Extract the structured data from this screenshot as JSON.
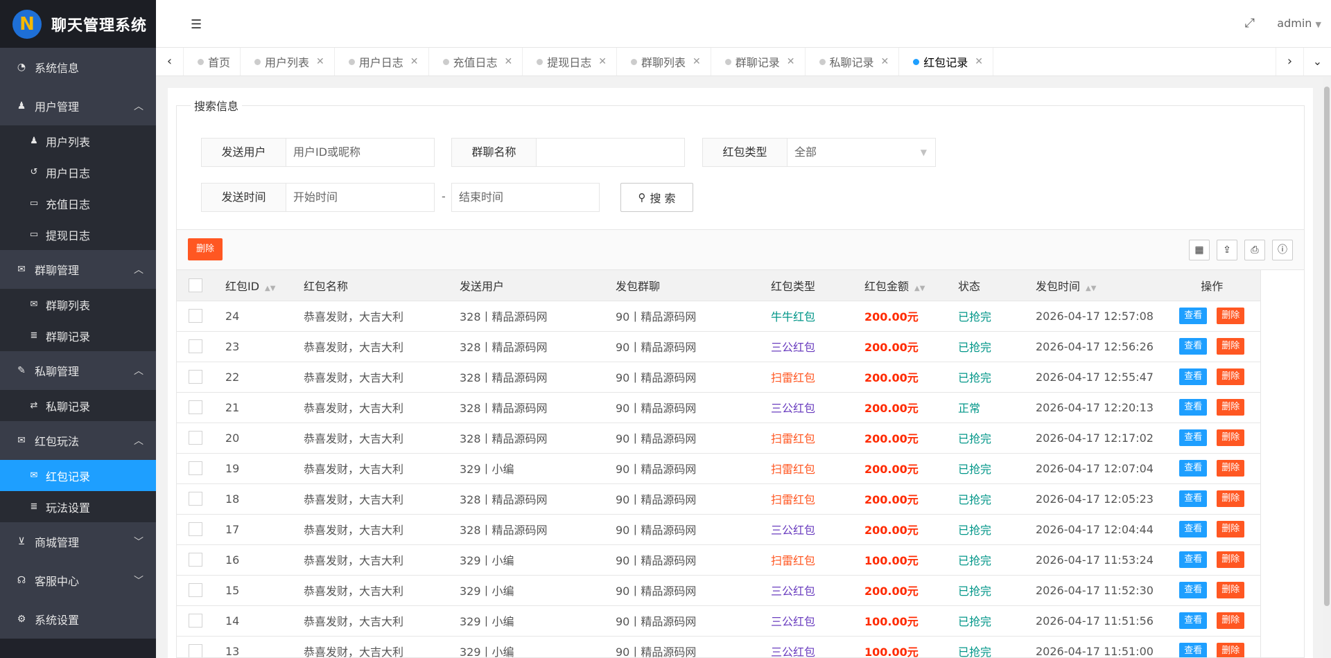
{
  "app": {
    "title": "聊天管理系统"
  },
  "sidebar": {
    "groups": [
      {
        "label": "系统信息",
        "icon": "dashboard-icon",
        "children": []
      },
      {
        "label": "用户管理",
        "icon": "user-icon",
        "expanded": true,
        "children": [
          {
            "label": "用户列表",
            "icon": "users-icon"
          },
          {
            "label": "用户日志",
            "icon": "history-icon"
          },
          {
            "label": "充值日志",
            "icon": "card-icon"
          },
          {
            "label": "提现日志",
            "icon": "card-icon"
          }
        ]
      },
      {
        "label": "群聊管理",
        "icon": "chat-icon",
        "expanded": true,
        "children": [
          {
            "label": "群聊列表",
            "icon": "chat-icon"
          },
          {
            "label": "群聊记录",
            "icon": "list-icon"
          }
        ]
      },
      {
        "label": "私聊管理",
        "icon": "comment-icon",
        "expanded": true,
        "children": [
          {
            "label": "私聊记录",
            "icon": "exchange-icon"
          }
        ]
      },
      {
        "label": "红包玩法",
        "icon": "chat-icon",
        "expanded": true,
        "children": [
          {
            "label": "红包记录",
            "icon": "chat-icon",
            "active": true
          },
          {
            "label": "玩法设置",
            "icon": "list-icon"
          }
        ]
      },
      {
        "label": "商城管理",
        "icon": "cart-icon",
        "expanded": false,
        "children": []
      },
      {
        "label": "客服中心",
        "icon": "headset-icon",
        "expanded": false,
        "children": []
      },
      {
        "label": "系统设置",
        "icon": "gears-icon",
        "children": []
      }
    ]
  },
  "header": {
    "user": "admin"
  },
  "tabs": [
    {
      "label": "首页",
      "closable": false
    },
    {
      "label": "用户列表",
      "closable": true
    },
    {
      "label": "用户日志",
      "closable": true
    },
    {
      "label": "充值日志",
      "closable": true
    },
    {
      "label": "提现日志",
      "closable": true
    },
    {
      "label": "群聊列表",
      "closable": true
    },
    {
      "label": "群聊记录",
      "closable": true
    },
    {
      "label": "私聊记录",
      "closable": true
    },
    {
      "label": "红包记录",
      "closable": true,
      "active": true
    }
  ],
  "search": {
    "legend": "搜索信息",
    "sender_label": "发送用户",
    "sender_placeholder": "用户ID或昵称",
    "group_label": "群聊名称",
    "group_value": "",
    "type_label": "红包类型",
    "type_value": "全部",
    "time_label": "发送时间",
    "start_placeholder": "开始时间",
    "dash": "-",
    "end_placeholder": "结束时间",
    "button": "搜 索"
  },
  "toolbar": {
    "delete_label": "删除"
  },
  "table": {
    "headers": [
      "红包ID",
      "红包名称",
      "发送用户",
      "发包群聊",
      "红包类型",
      "红包金额",
      "状态",
      "发包时间",
      "操作"
    ],
    "view_label": "查看",
    "delete_label": "删除",
    "rows": [
      {
        "id": "24",
        "name": "恭喜发财，大吉大利",
        "sender": "328丨精品源码网",
        "group": "90丨精品源码网",
        "type": "牛牛红包",
        "type_color": "#009688",
        "amount": "200.00元",
        "status": "已抢完",
        "time": "2026-04-17 12:57:08"
      },
      {
        "id": "23",
        "name": "恭喜发财，大吉大利",
        "sender": "328丨精品源码网",
        "group": "90丨精品源码网",
        "type": "三公红包",
        "type_color": "#6a3dbf",
        "amount": "200.00元",
        "status": "已抢完",
        "time": "2026-04-17 12:56:26"
      },
      {
        "id": "22",
        "name": "恭喜发财，大吉大利",
        "sender": "328丨精品源码网",
        "group": "90丨精品源码网",
        "type": "扫雷红包",
        "type_color": "#ff5722",
        "amount": "200.00元",
        "status": "已抢完",
        "time": "2026-04-17 12:55:47"
      },
      {
        "id": "21",
        "name": "恭喜发财，大吉大利",
        "sender": "328丨精品源码网",
        "group": "90丨精品源码网",
        "type": "三公红包",
        "type_color": "#6a3dbf",
        "amount": "200.00元",
        "status": "正常",
        "time": "2026-04-17 12:20:13"
      },
      {
        "id": "20",
        "name": "恭喜发财，大吉大利",
        "sender": "328丨精品源码网",
        "group": "90丨精品源码网",
        "type": "扫雷红包",
        "type_color": "#ff5722",
        "amount": "200.00元",
        "status": "已抢完",
        "time": "2026-04-17 12:17:02"
      },
      {
        "id": "19",
        "name": "恭喜发财，大吉大利",
        "sender": "329丨小编",
        "group": "90丨精品源码网",
        "type": "扫雷红包",
        "type_color": "#ff5722",
        "amount": "200.00元",
        "status": "已抢完",
        "time": "2026-04-17 12:07:04"
      },
      {
        "id": "18",
        "name": "恭喜发财，大吉大利",
        "sender": "328丨精品源码网",
        "group": "90丨精品源码网",
        "type": "扫雷红包",
        "type_color": "#ff5722",
        "amount": "200.00元",
        "status": "已抢完",
        "time": "2026-04-17 12:05:23"
      },
      {
        "id": "17",
        "name": "恭喜发财，大吉大利",
        "sender": "328丨精品源码网",
        "group": "90丨精品源码网",
        "type": "三公红包",
        "type_color": "#6a3dbf",
        "amount": "200.00元",
        "status": "已抢完",
        "time": "2026-04-17 12:04:44"
      },
      {
        "id": "16",
        "name": "恭喜发财，大吉大利",
        "sender": "329丨小编",
        "group": "90丨精品源码网",
        "type": "扫雷红包",
        "type_color": "#ff5722",
        "amount": "100.00元",
        "status": "已抢完",
        "time": "2026-04-17 11:53:24"
      },
      {
        "id": "15",
        "name": "恭喜发财，大吉大利",
        "sender": "329丨小编",
        "group": "90丨精品源码网",
        "type": "三公红包",
        "type_color": "#6a3dbf",
        "amount": "200.00元",
        "status": "已抢完",
        "time": "2026-04-17 11:52:30"
      },
      {
        "id": "14",
        "name": "恭喜发财，大吉大利",
        "sender": "329丨小编",
        "group": "90丨精品源码网",
        "type": "三公红包",
        "type_color": "#6a3dbf",
        "amount": "100.00元",
        "status": "已抢完",
        "time": "2026-04-17 11:51:56"
      },
      {
        "id": "13",
        "name": "恭喜发财，大吉大利",
        "sender": "329丨小编",
        "group": "90丨精品源码网",
        "type": "三公红包",
        "type_color": "#6a3dbf",
        "amount": "100.00元",
        "status": "已抢完",
        "time": "2026-04-17 11:51:00"
      }
    ]
  },
  "colors": {
    "accent": "#1e9fff",
    "danger": "#ff5722",
    "sidebar": "#20222a",
    "status_green": "#009688"
  }
}
